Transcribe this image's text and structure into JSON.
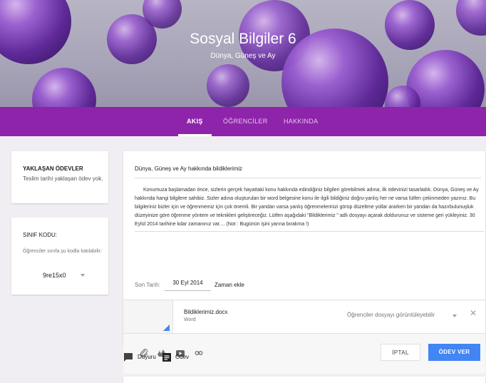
{
  "banner": {
    "title": "Sosyal Bilgiler 6",
    "subtitle": "Dünya, Güneş ve Ay"
  },
  "tabs": [
    {
      "label": "AKIŞ",
      "active": true
    },
    {
      "label": "ÖĞRENCİLER",
      "active": false
    },
    {
      "label": "HAKKINDA",
      "active": false
    }
  ],
  "upcoming": {
    "heading": "YAKLAŞAN ÖDEVLER",
    "text": "Teslim tarihi yaklaşan ödev yok."
  },
  "class_code": {
    "label": "SINIF KODU:",
    "hint": "Öğrenciler sınıfa şu kodla katılabilir:",
    "value": "9re15x0"
  },
  "assignment": {
    "title": "Dünya, Güneş ve Ay hakkında bildiklerimiz",
    "body": "Konumuza başlamadan önce, sizlerin gerçek hayattaki konu hakkında edindiğiniz bilgileri görebilmek adına; ilk ödevinizi tasarladık. Dünya, Güneş ve Ay hakkında hangi bilgilere sahibiz. Sizler adına oluşturulan bir word belgesine konu ile ilgili bildiğiniz doğru-yanlış her ne varsa lütfen çekinmeden yazınız. Bu bilgileriniz bizler için ve öğrenmemiz için çok önemli. Bir yandan varsa yanlış öğrenmelerinizi görüp düzeltme yollar ararken bir yandan da hazırbulunuşluk düzeyinize göre öğrenme yöntem ve teknikleri geliştireceğiz. Lütfen aşağıdaki \"Bildiklerimiz \" adlı dosyayı açarak doldurunuz ve sisteme geri yükleyiniz. 30 Eylül 2014 tarihine kdar zamanınız var.... (Not : Bugünün işini yarına bırakma !)",
    "due_label": "Son Tarih:",
    "due_value": "30 Eyl 2014",
    "add_time": "Zaman ekle",
    "attachment": {
      "name": "Bildiklerimiz.docx",
      "type": "Word",
      "share_option": "Öğrenciler dosyayı görüntüleyebilir"
    },
    "cancel_label": "İPTAL",
    "submit_label": "ÖDEV VER"
  },
  "post_types": [
    {
      "label": "Duyuru",
      "icon": "announcement-icon"
    },
    {
      "label": "Ödev",
      "icon": "assignment-icon"
    }
  ],
  "colors": {
    "tab_bar": "#8e24aa",
    "primary_button": "#4285f4",
    "background": "#f0eef2"
  }
}
